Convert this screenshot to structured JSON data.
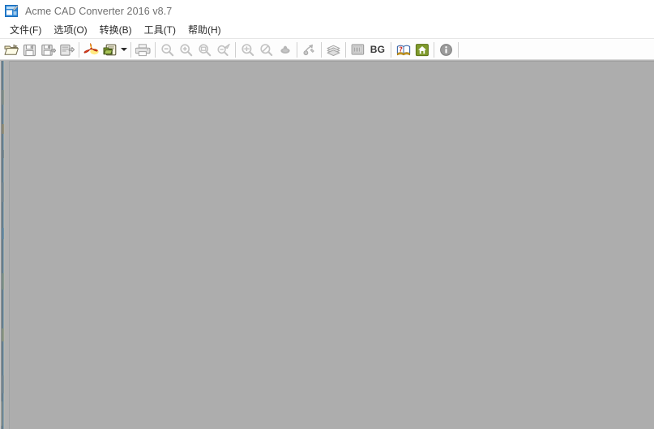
{
  "window": {
    "title": "Acme CAD Converter 2016 v8.7",
    "app_icon": "acme-cad-app-icon"
  },
  "menubar": {
    "items": [
      {
        "label": "文件(F)",
        "name": "menu-file"
      },
      {
        "label": "选项(O)",
        "name": "menu-options"
      },
      {
        "label": "转换(B)",
        "name": "menu-convert"
      },
      {
        "label": "工具(T)",
        "name": "menu-tools"
      },
      {
        "label": "帮助(H)",
        "name": "menu-help"
      }
    ]
  },
  "toolbar": {
    "buttons": [
      {
        "name": "open-file-icon",
        "icon": "open-folder",
        "enabled": true,
        "tooltip": "Open"
      },
      {
        "name": "save-icon",
        "icon": "save-disk",
        "enabled": false,
        "tooltip": "Save"
      },
      {
        "name": "save-as-icon",
        "icon": "save-as-disk",
        "enabled": false,
        "tooltip": "Save As"
      },
      {
        "name": "batch-convert-icon",
        "icon": "batch-convert",
        "enabled": false,
        "tooltip": "Batch Convert"
      },
      {
        "name": "export-pdf-icon",
        "icon": "pdf-red",
        "enabled": true,
        "tooltip": "Convert to PDF"
      },
      {
        "name": "export-image-icon",
        "icon": "export-image",
        "enabled": true,
        "tooltip": "Convert to Image"
      },
      {
        "name": "export-image-dropdown",
        "icon": "chevron-down",
        "enabled": true,
        "tooltip": "More formats"
      },
      {
        "name": "print-icon",
        "icon": "printer",
        "enabled": false,
        "tooltip": "Print"
      },
      {
        "name": "zoom-out-icon",
        "icon": "magnifier-minus",
        "enabled": false,
        "tooltip": "Zoom Out"
      },
      {
        "name": "zoom-in-icon",
        "icon": "magnifier-plus",
        "enabled": false,
        "tooltip": "Zoom In"
      },
      {
        "name": "zoom-window-icon",
        "icon": "magnifier-window",
        "enabled": false,
        "tooltip": "Zoom Window"
      },
      {
        "name": "zoom-extents-icon",
        "icon": "zoom-extents",
        "enabled": false,
        "tooltip": "Zoom Extents"
      },
      {
        "name": "zoom-realtime-icon",
        "icon": "magnifier-real",
        "enabled": false,
        "tooltip": "Zoom Realtime"
      },
      {
        "name": "zoom-previous-icon",
        "icon": "magnifier-prev",
        "enabled": false,
        "tooltip": "Zoom Previous"
      },
      {
        "name": "pan-icon",
        "icon": "pan-hand",
        "enabled": false,
        "tooltip": "Pan"
      },
      {
        "name": "measure-icon",
        "icon": "measure-tool",
        "enabled": false,
        "tooltip": "Measure"
      },
      {
        "name": "layers-icon",
        "icon": "layers-stack",
        "enabled": false,
        "tooltip": "Layers"
      },
      {
        "name": "view-panel-icon",
        "icon": "panel-view",
        "enabled": false,
        "tooltip": "View Panel"
      },
      {
        "name": "background-color-button",
        "icon": "text-bg",
        "enabled": true,
        "label": "BG",
        "tooltip": "Background Color"
      },
      {
        "name": "help-icon",
        "icon": "help-book",
        "enabled": true,
        "tooltip": "Help"
      },
      {
        "name": "home-icon",
        "icon": "home-house",
        "enabled": true,
        "tooltip": "Home Page"
      },
      {
        "name": "about-icon",
        "icon": "info-circle",
        "enabled": true,
        "tooltip": "About"
      }
    ],
    "bg_label": "BG"
  },
  "sidebar": {
    "name": "collapsed-file-panel",
    "collapsed": true
  },
  "canvas": {
    "name": "drawing-canvas",
    "empty": true,
    "background_color": "#adadad"
  },
  "colors": {
    "titlebar_bg": "#ffffff",
    "title_text": "#6f6f6f",
    "menu_text": "#2b2b2b",
    "toolbar_bg": "#fdfdfd",
    "canvas_bg": "#adadad",
    "separator": "#cfcfcf",
    "accent_blue": "#2e7cc4",
    "pdf_red": "#d42a12",
    "home_green": "#6f8f2a",
    "disabled_gray": "#c2c2c2",
    "enabled_gray": "#8a8a7a"
  }
}
